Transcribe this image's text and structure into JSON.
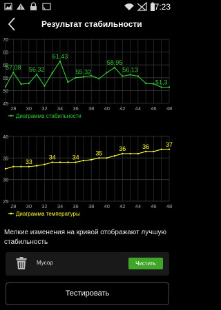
{
  "status_bar": {
    "time": "7:23",
    "icons": [
      "image-icon",
      "alert-icon",
      "lock-icon",
      "cast-icon",
      "wifi-icon",
      "no-sim-icon",
      "battery-icon"
    ]
  },
  "header": {
    "title": "Результат стабильности"
  },
  "colors": {
    "stability": "#33cc33",
    "temperature": "#ffff33",
    "clean_button": "#3fa628",
    "grid": "#3a3a3a"
  },
  "chart_data": [
    {
      "type": "line",
      "series": [
        {
          "name": "Диаграмма стабильности",
          "x": [
            27,
            28,
            29,
            30,
            31,
            32,
            33,
            34,
            35,
            36,
            37,
            38,
            39,
            40,
            41,
            42,
            43,
            44,
            45,
            46,
            47,
            48
          ],
          "values": [
            51.5,
            57.08,
            52.5,
            52.8,
            56.32,
            51.8,
            56.8,
            61.43,
            53.3,
            55.0,
            55.32,
            55.8,
            54.6,
            57.0,
            58.95,
            55.6,
            56.13,
            55.6,
            52.8,
            52.6,
            51.3,
            51.3
          ]
        }
      ],
      "data_labels": [
        "57,08",
        "56,32",
        "61,43",
        "55,32",
        "58,95",
        "56,13",
        "51,3"
      ],
      "label_indices": [
        1,
        4,
        7,
        10,
        14,
        16,
        20
      ],
      "xlim": [
        27,
        48
      ],
      "ylim": [
        45,
        70
      ],
      "x_ticks": [
        "28",
        "30",
        "32",
        "34",
        "36",
        "38",
        "40",
        "42",
        "44",
        "46",
        "48"
      ],
      "y_ticks": [
        "45",
        "50",
        "55",
        "60",
        "65",
        "70"
      ],
      "grid": true,
      "legend": "bottom-left"
    },
    {
      "type": "line",
      "series": [
        {
          "name": "Диаграмма температуры",
          "x": [
            27,
            28,
            29,
            30,
            31,
            32,
            33,
            34,
            35,
            36,
            37,
            38,
            39,
            40,
            41,
            42,
            43,
            44,
            45,
            46,
            47,
            48
          ],
          "values": [
            32.5,
            33,
            33,
            33,
            33.2,
            33.5,
            34,
            34,
            34,
            34,
            34.4,
            34.6,
            35,
            35,
            35.5,
            36,
            36,
            36,
            36.5,
            36.5,
            37,
            37
          ]
        }
      ],
      "data_labels": [
        "33",
        "34",
        "34",
        "35",
        "36",
        "36",
        "37"
      ],
      "label_indices": [
        3,
        6,
        9,
        12,
        15,
        18,
        21
      ],
      "xlim": [
        27,
        48
      ],
      "ylim": [
        25,
        40
      ],
      "x_ticks": [
        "28",
        "30",
        "32",
        "34",
        "36",
        "38",
        "40",
        "42",
        "44",
        "46",
        "48"
      ],
      "y_ticks": [
        "25",
        "30",
        "35",
        "40"
      ],
      "grid": true,
      "legend": "bottom-left"
    }
  ],
  "info": {
    "text": "Мелкие изменения на кривой отображают лучшую стабильность"
  },
  "trash": {
    "label": "Мусор",
    "button_label": "Чистить"
  },
  "test_button_label": "Тестировать"
}
